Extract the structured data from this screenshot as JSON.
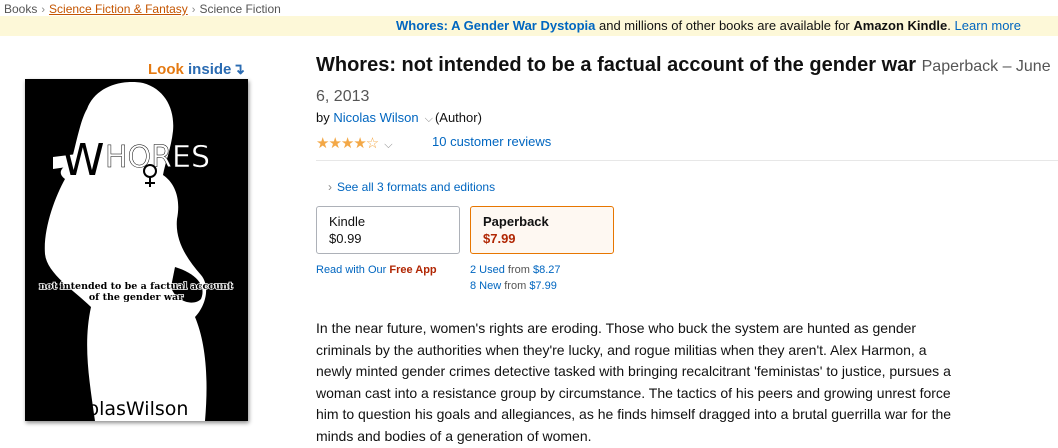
{
  "breadcrumb": {
    "items": [
      "Books",
      "Science Fiction & Fantasy",
      "Science Fiction"
    ],
    "separator": "›"
  },
  "banner": {
    "book_link": "Whores: A Gender War Dystopia",
    "middle_text": " and millions of other books are available for ",
    "kindle_text": "Amazon Kindle",
    "period": ". ",
    "learn_more": "Learn more"
  },
  "look_inside": {
    "word1": "Look",
    "word2": "inside",
    "arrow": "↴"
  },
  "cover": {
    "title_text": "WHORES",
    "tagline_line1": "not intended to be a factual account",
    "tagline_line2": "of the gender war",
    "author_text": "NicolasWilson"
  },
  "product": {
    "title": "Whores: not intended to be a factual account of the gender war",
    "format": "Paperback – June 6, 2013",
    "by_label": "by ",
    "author": "Nicolas Wilson",
    "author_role": "(Author)",
    "stars_display": "★★★★☆",
    "rating_fraction": 0.8,
    "reviews_label": "10 customer reviews",
    "see_formats": "See all 3 formats and editions"
  },
  "formats": [
    {
      "name": "Kindle",
      "price": "$0.99",
      "selected": false
    },
    {
      "name": "Paperback",
      "price": "$7.99",
      "selected": true
    }
  ],
  "kindle_sub": {
    "prefix": "Read with Our ",
    "highlight": "Free App"
  },
  "paperback_sub": {
    "used_count": "2 Used",
    "used_from": " from ",
    "used_price": "$8.27",
    "new_count": "8 New",
    "new_from": " from ",
    "new_price": "$7.99"
  },
  "description": "In the near future, women's rights are eroding. Those who buck the system are hunted as gender criminals by the authorities when they're lucky, and rogue militias when they aren't. Alex Harmon, a newly minted gender crimes detective tasked with bringing recalcitrant 'feministas' to justice, pursues a woman cast into a resistance group by circumstance. The tactics of his peers and growing unrest force him to question his goals and allegiances, as he finds himself dragged into a brutal guerrilla war for the minds and bodies of a generation of women.",
  "colors": {
    "link": "#0066c0",
    "price_red": "#b12704",
    "star": "#f3a847",
    "banner_bg": "#fdf8d8",
    "look_orange": "#e47911",
    "selected_border": "#e77600"
  }
}
